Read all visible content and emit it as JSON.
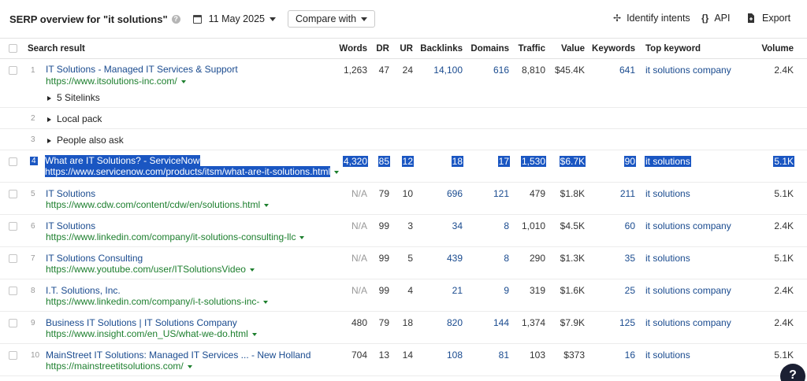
{
  "toolbar": {
    "title": "SERP overview for \"it solutions\"",
    "help_icon": "?",
    "date": "11 May 2025",
    "compare_label": "Compare with",
    "identify_label": "Identify intents",
    "api_label": "API",
    "api_icon": "{}",
    "export_label": "Export"
  },
  "columns": {
    "search_result": "Search result",
    "words": "Words",
    "dr": "DR",
    "ur": "UR",
    "backlinks": "Backlinks",
    "domains": "Domains",
    "traffic": "Traffic",
    "value": "Value",
    "keywords": "Keywords",
    "top_keyword": "Top keyword",
    "volume": "Volume"
  },
  "rows": [
    {
      "n": "1",
      "title": "IT Solutions - Managed IT Services & Support",
      "url": "https://www.itsolutions-inc.com/",
      "sitelinks": "5 Sitelinks",
      "words": "1,263",
      "dr": "47",
      "ur": "24",
      "backlinks": "14,100",
      "domains": "616",
      "traffic": "8,810",
      "value": "$45.4K",
      "keywords": "641",
      "top_keyword": "it solutions company",
      "volume": "2.4K"
    },
    {
      "n": "2",
      "label": "Local pack"
    },
    {
      "n": "3",
      "label": "People also ask"
    },
    {
      "n": "4",
      "title": "What are IT Solutions? - ServiceNow",
      "url": "https://www.servicenow.com/products/itsm/what-are-it-solutions.html",
      "words": "4,320",
      "dr": "85",
      "ur": "12",
      "backlinks": "18",
      "domains": "17",
      "traffic": "1,530",
      "value": "$6.7K",
      "keywords": "90",
      "top_keyword": "it solutions",
      "volume": "5.1K"
    },
    {
      "n": "5",
      "title": "IT Solutions",
      "url": "https://www.cdw.com/content/cdw/en/solutions.html",
      "words": "N/A",
      "dr": "79",
      "ur": "10",
      "backlinks": "696",
      "domains": "121",
      "traffic": "479",
      "value": "$1.8K",
      "keywords": "211",
      "top_keyword": "it solutions",
      "volume": "5.1K"
    },
    {
      "n": "6",
      "title": "IT Solutions",
      "url": "https://www.linkedin.com/company/it-solutions-consulting-llc",
      "words": "N/A",
      "dr": "99",
      "ur": "3",
      "backlinks": "34",
      "domains": "8",
      "traffic": "1,010",
      "value": "$4.5K",
      "keywords": "60",
      "top_keyword": "it solutions company",
      "volume": "2.4K"
    },
    {
      "n": "7",
      "title": "IT Solutions Consulting",
      "url": "https://www.youtube.com/user/ITSolutionsVideo",
      "words": "N/A",
      "dr": "99",
      "ur": "5",
      "backlinks": "439",
      "domains": "8",
      "traffic": "290",
      "value": "$1.3K",
      "keywords": "35",
      "top_keyword": "it solutions",
      "volume": "5.1K"
    },
    {
      "n": "8",
      "title": "I.T. Solutions, Inc.",
      "url": "https://www.linkedin.com/company/i-t-solutions-inc-",
      "words": "N/A",
      "dr": "99",
      "ur": "4",
      "backlinks": "21",
      "domains": "9",
      "traffic": "319",
      "value": "$1.6K",
      "keywords": "25",
      "top_keyword": "it solutions company",
      "volume": "2.4K"
    },
    {
      "n": "9",
      "title": "Business IT Solutions | IT Solutions Company",
      "url": "https://www.insight.com/en_US/what-we-do.html",
      "words": "480",
      "dr": "79",
      "ur": "18",
      "backlinks": "820",
      "domains": "144",
      "traffic": "1,374",
      "value": "$7.9K",
      "keywords": "125",
      "top_keyword": "it solutions company",
      "volume": "2.4K"
    },
    {
      "n": "10",
      "title": "MainStreet IT Solutions: Managed IT Services ... - New Holland",
      "url": "https://mainstreetitsolutions.com/",
      "words": "704",
      "dr": "13",
      "ur": "14",
      "backlinks": "108",
      "domains": "81",
      "traffic": "103",
      "value": "$373",
      "keywords": "16",
      "top_keyword": "it solutions",
      "volume": "5.1K"
    }
  ],
  "help_widget": "?"
}
